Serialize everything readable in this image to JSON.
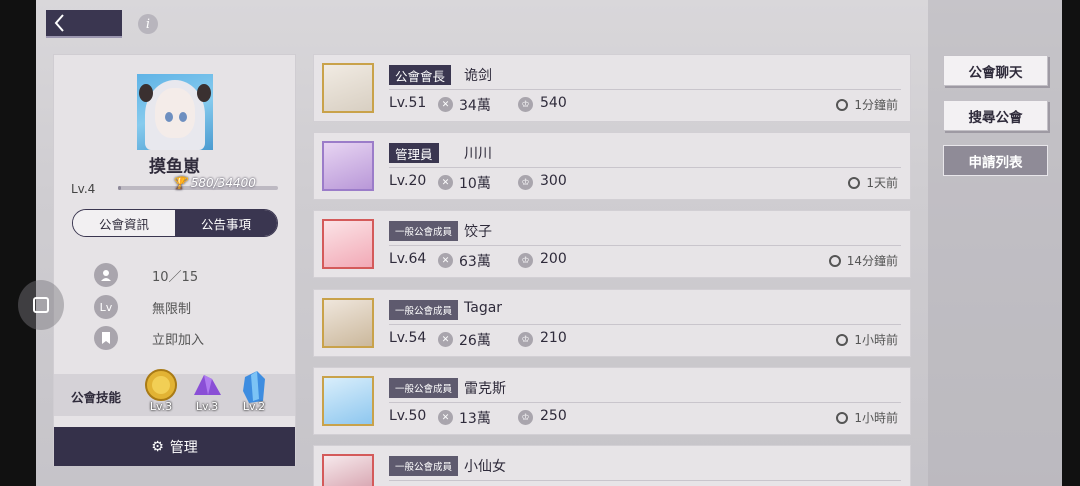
{
  "top": {
    "info_glyph": "i"
  },
  "guild": {
    "name": "摸鱼崽",
    "level": "Lv.4",
    "exp_text": "580/34400",
    "exp_progress": 0.017,
    "tabs": [
      {
        "label": "公會資訊",
        "active": true
      },
      {
        "label": "公告事項",
        "active": false
      }
    ],
    "info": [
      {
        "icon": "member-icon",
        "value": "10／15"
      },
      {
        "icon": "level-icon",
        "glyph": "Lv",
        "value": "無限制"
      },
      {
        "icon": "bookmark-icon",
        "value": "立即加入"
      }
    ],
    "skills_label": "公會技能",
    "skills": [
      {
        "icon": "gold-coin-icon",
        "level": "Lv.3"
      },
      {
        "icon": "purple-gem-icon",
        "level": "Lv.3"
      },
      {
        "icon": "blue-crystal-icon",
        "level": "Lv.2"
      }
    ],
    "manage_label": "管理"
  },
  "members": [
    {
      "role": "公會會長",
      "role_small": false,
      "name": "诡剑",
      "level": "Lv.51",
      "power": "34萬",
      "trophies": "540",
      "last_seen": "1分鐘前",
      "frame": "gold"
    },
    {
      "role": "管理員",
      "role_small": false,
      "name": "川川",
      "level": "Lv.20",
      "power": "10萬",
      "trophies": "300",
      "last_seen": "1天前",
      "frame": "purple"
    },
    {
      "role": "一般公會成員",
      "role_small": true,
      "name": "饺子",
      "level": "Lv.64",
      "power": "63萬",
      "trophies": "200",
      "last_seen": "14分鐘前",
      "frame": "red"
    },
    {
      "role": "一般公會成員",
      "role_small": true,
      "name": "Tagar",
      "level": "Lv.54",
      "power": "26萬",
      "trophies": "210",
      "last_seen": "1小時前",
      "frame": "gold"
    },
    {
      "role": "一般公會成員",
      "role_small": true,
      "name": "雷克斯",
      "level": "Lv.50",
      "power": "13萬",
      "trophies": "250",
      "last_seen": "1小時前",
      "frame": "gold"
    },
    {
      "role": "一般公會成員",
      "role_small": true,
      "name": "小仙女",
      "frame": "red"
    }
  ],
  "right_buttons": [
    {
      "label": "公會聊天"
    },
    {
      "label": "搜尋公會"
    },
    {
      "label": "申請列表"
    }
  ],
  "colors": {
    "accent": "#3a3650",
    "panel": "#e6e3e6",
    "gold_frame": "#c9a24a"
  }
}
